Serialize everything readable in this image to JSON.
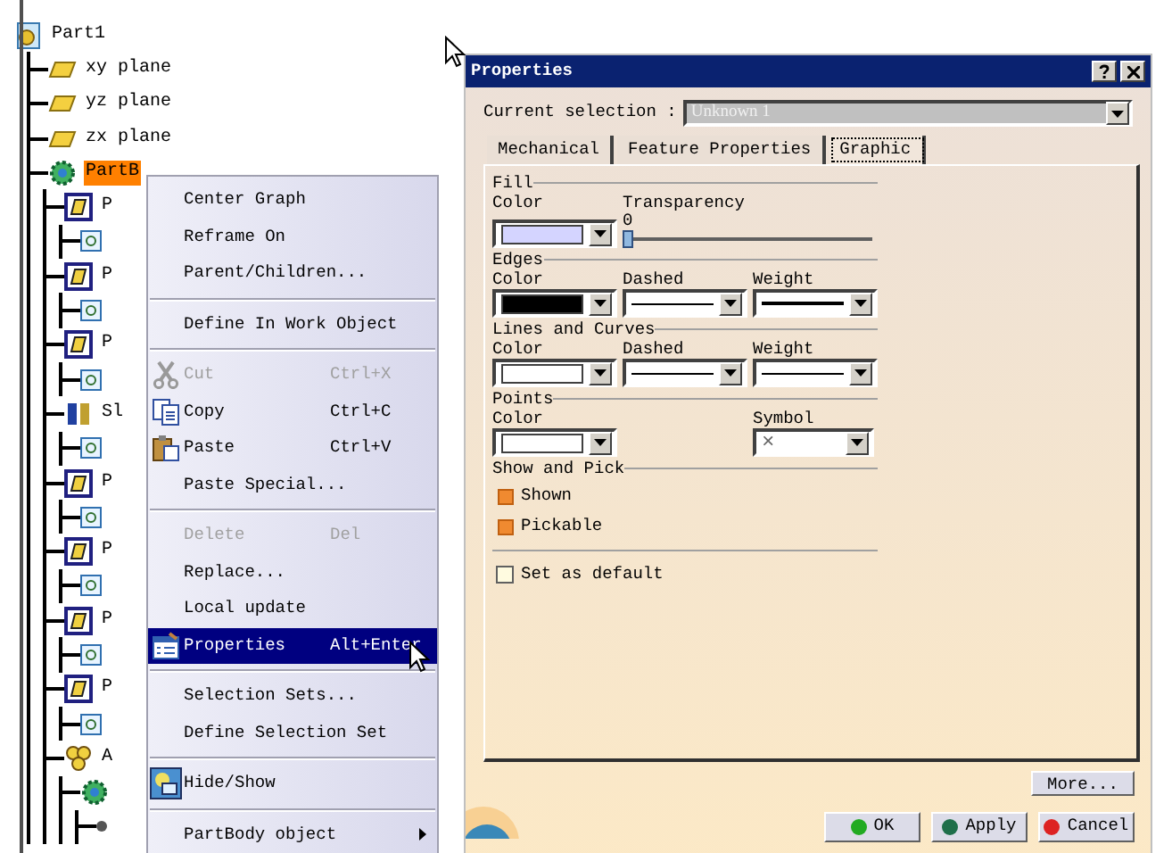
{
  "tree": {
    "label": "Part1",
    "kind": "part",
    "selected": false,
    "children": [
      {
        "label": "xy plane",
        "kind": "plane",
        "selected": false
      },
      {
        "label": "yz plane",
        "kind": "plane",
        "selected": false
      },
      {
        "label": "zx plane",
        "kind": "plane",
        "selected": false
      },
      {
        "label": "PartB",
        "kind": "body",
        "selected": true,
        "children": [
          {
            "label": "P",
            "kind": "pad",
            "selected": false,
            "children": [
              {
                "kind": "sketch"
              }
            ]
          },
          {
            "label": "P",
            "kind": "pad",
            "selected": false,
            "children": [
              {
                "kind": "sketch"
              }
            ]
          },
          {
            "label": "P",
            "kind": "pad",
            "selected": false,
            "children": [
              {
                "kind": "sketch"
              }
            ]
          },
          {
            "label": "Sl",
            "kind": "shaft",
            "selected": false,
            "children": [
              {
                "kind": "sketch"
              }
            ]
          },
          {
            "label": "P",
            "kind": "pad",
            "selected": false,
            "children": [
              {
                "kind": "sketch"
              }
            ]
          },
          {
            "label": "P",
            "kind": "pad",
            "selected": false,
            "children": [
              {
                "kind": "sketch"
              }
            ]
          },
          {
            "label": "P",
            "kind": "pad",
            "selected": false,
            "children": [
              {
                "kind": "sketch"
              }
            ]
          },
          {
            "label": "P",
            "kind": "pad",
            "selected": false,
            "children": [
              {
                "kind": "sketch"
              }
            ]
          },
          {
            "label": "A",
            "kind": "set",
            "selected": false,
            "children": [
              {
                "kind": "body",
                "children": [
                  {
                    "kind": "stub"
                  }
                ]
              }
            ]
          }
        ]
      }
    ]
  },
  "context_menu": {
    "sections": [
      [
        {
          "label": "Center Graph",
          "disabled": false,
          "selected": false
        },
        {
          "label": "Reframe On",
          "disabled": false,
          "selected": false
        },
        {
          "label": "Parent/Children...",
          "disabled": false,
          "selected": false
        }
      ],
      [
        {
          "label": "Define In Work Object",
          "disabled": false,
          "selected": false
        }
      ],
      [
        {
          "label": "Cut",
          "shortcut": "Ctrl+X",
          "kind": "cut",
          "disabled": true,
          "selected": false
        },
        {
          "label": "Copy",
          "shortcut": "Ctrl+C",
          "kind": "copy",
          "disabled": false,
          "selected": false
        },
        {
          "label": "Paste",
          "shortcut": "Ctrl+V",
          "kind": "paste",
          "disabled": false,
          "selected": false
        },
        {
          "label": "Paste Special...",
          "disabled": false,
          "selected": false
        }
      ],
      [
        {
          "label": "Delete",
          "shortcut": "Del",
          "disabled": true,
          "selected": false
        },
        {
          "label": "Replace...",
          "disabled": false,
          "selected": false
        },
        {
          "label": "Local update",
          "disabled": false,
          "selected": false
        },
        {
          "label": "Properties",
          "shortcut": "Alt+Enter",
          "kind": "properties",
          "disabled": false,
          "selected": true
        }
      ],
      [
        {
          "label": "Selection Sets...",
          "disabled": false,
          "selected": false
        },
        {
          "label": "Define Selection Set",
          "disabled": false,
          "selected": false
        }
      ],
      [
        {
          "label": "Hide/Show",
          "kind": "hideshow",
          "disabled": false,
          "selected": false
        }
      ],
      [
        {
          "label": "PartBody object",
          "submenu": true,
          "disabled": false,
          "selected": false
        }
      ]
    ]
  },
  "dialog": {
    "title": "Properties",
    "current_selection": {
      "label": "Current selection :",
      "value": "Unknown 1",
      "disabled": true
    },
    "tabs": [
      {
        "label": "Mechanical",
        "selected": false
      },
      {
        "label": "Feature Properties",
        "selected": false
      },
      {
        "label": "Graphic",
        "selected": true
      }
    ],
    "sections": [
      {
        "title": "Fill",
        "fields": [
          {
            "kind": "color",
            "label": "Color",
            "color": "#d4d4ff"
          },
          {
            "kind": "slider",
            "label": "Transparency",
            "reading": "0",
            "level": 0
          }
        ]
      },
      {
        "title": "Edges",
        "fields": [
          {
            "kind": "color",
            "label": "Color",
            "color": "#000000"
          },
          {
            "kind": "line",
            "label": "Dashed",
            "thick": false
          },
          {
            "kind": "line",
            "label": "Weight",
            "thick": true
          }
        ]
      },
      {
        "title": "Lines and Curves",
        "fields": [
          {
            "kind": "color",
            "label": "Color",
            "color": "#ffffff"
          },
          {
            "kind": "line",
            "label": "Dashed",
            "thick": false
          },
          {
            "kind": "line",
            "label": "Weight",
            "thick": false
          }
        ]
      },
      {
        "title": "Points",
        "fields": [
          {
            "kind": "color",
            "label": "Color",
            "color": "#ffffff"
          },
          {
            "kind": "symbol",
            "label": "Symbol",
            "value": "×"
          }
        ]
      },
      {
        "title": "Show and Pick",
        "fields": [
          {
            "kind": "check",
            "label": "Shown",
            "checked": true
          },
          {
            "kind": "check",
            "label": "Pickable",
            "checked": true
          }
        ]
      }
    ],
    "set_as_default": {
      "label": "Set as default",
      "checked": false
    },
    "more_button": "More...",
    "buttons": [
      {
        "label": "OK",
        "color": "#22aa22"
      },
      {
        "label": "Apply",
        "color": "#1f6f4a"
      },
      {
        "label": "Cancel",
        "color": "#dd2222"
      }
    ]
  }
}
